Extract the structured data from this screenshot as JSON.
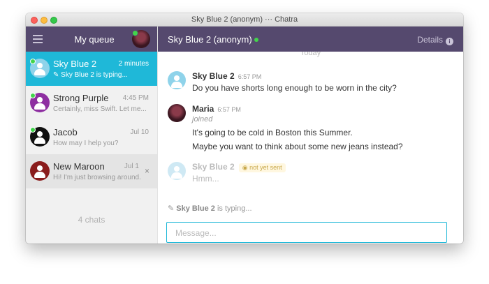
{
  "window": {
    "title": "Sky Blue 2 (anonym) ··· Chatra"
  },
  "sidebar": {
    "title": "My queue",
    "chats": [
      {
        "name": "Sky Blue 2",
        "time": "2 minutes",
        "preview": "Sky Blue 2 is typing...",
        "color": "#8fd3ea",
        "online": true,
        "typing": true
      },
      {
        "name": "Strong Purple",
        "time": "4:45 PM",
        "preview": "Certainly, miss Swift. Let me...",
        "color": "#8e2fa1",
        "online": true
      },
      {
        "name": "Jacob",
        "time": "Jul 10",
        "preview": "How may I help you?",
        "color": "#111111",
        "online": true
      },
      {
        "name": "New Maroon",
        "time": "Jul 1",
        "preview": "Hi! I'm just browsing around...",
        "color": "#8a1c1c",
        "online": false
      }
    ],
    "count_label": "4 chats"
  },
  "conversation": {
    "title": "Sky Blue 2 (anonym)",
    "details_label": "Details",
    "day_label": "Today",
    "messages": [
      {
        "author": "Sky Blue 2",
        "time": "6:57 PM",
        "lines": [
          "Do you have shorts long enough to be worn in the city?"
        ]
      },
      {
        "author": "Maria",
        "time": "6:57 PM",
        "status": "joined",
        "lines": [
          "It's going to be cold in Boston this Summer.",
          "Maybe you want to think about some new jeans instead?"
        ]
      },
      {
        "author": "Sky Blue 2",
        "status_badge": "not yet sent",
        "lines": [
          "Hmm..."
        ]
      }
    ],
    "typing_user": "Sky Blue 2",
    "typing_text": "is typing...",
    "input_placeholder": "Message..."
  },
  "colors": {
    "header": "#55496e",
    "accent": "#1fb8d8",
    "online": "#42d44b"
  }
}
